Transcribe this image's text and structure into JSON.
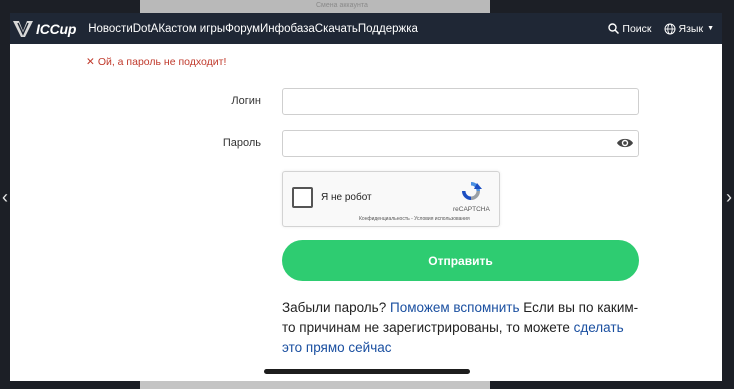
{
  "background": {
    "faint_text": "Смена аккаунта"
  },
  "nav": {
    "logo_text": "ICCup",
    "links": [
      "Новости",
      "DotA",
      "Кастом игры",
      "Форум",
      "Инфобаза",
      "Скачать",
      "Поддержка"
    ],
    "search_label": "Поиск",
    "lang_label": "Язык"
  },
  "form": {
    "error": "Ой, а пароль не подходит!",
    "login_label": "Логин",
    "login_value": "",
    "password_label": "Пароль",
    "password_value": "",
    "captcha": {
      "label": "Я не робот",
      "brand": "reCAPTCHA",
      "links": "Конфиденциальность - Условия использования"
    },
    "submit_label": "Отправить"
  },
  "help": {
    "text1": "Забыли пароль? ",
    "link1": "Поможем вспомнить",
    "text2": " Если вы по каким-то причинам не зарегистрированы, то можете ",
    "link2": "сделать это прямо сейчас"
  },
  "colors": {
    "nav_bg": "#1f2735",
    "accent_green": "#2ecc71",
    "error_red": "#c0392b",
    "link_blue": "#1a4fa0"
  },
  "icons": [
    "logo-mark-icon",
    "search-icon",
    "globe-icon",
    "eye-icon",
    "recaptcha-icon",
    "chevron-left-icon",
    "chevron-right-icon"
  ]
}
